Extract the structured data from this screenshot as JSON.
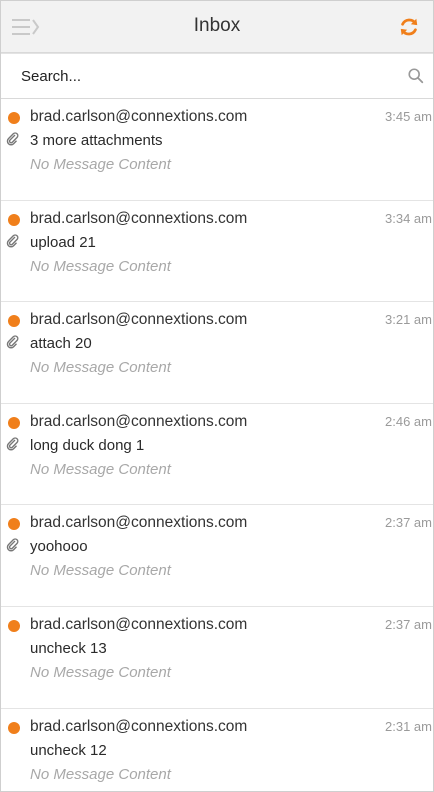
{
  "header": {
    "title": "Inbox",
    "menu_icon": "menu-collapse-icon",
    "refresh_icon": "refresh-icon"
  },
  "search": {
    "placeholder": "Search...",
    "value": "",
    "icon": "search-icon"
  },
  "colors": {
    "accent": "#f07f1b",
    "unread_dot": "#f07f1b",
    "header_bg": "#f2f2f2"
  },
  "messages": [
    {
      "from": "brad.carlson@connextions.com",
      "time": "3:45 am",
      "subject": "3 more attachments",
      "preview": "No Message Content",
      "unread": true,
      "has_attachment": true
    },
    {
      "from": "brad.carlson@connextions.com",
      "time": "3:34 am",
      "subject": "upload 21",
      "preview": "No Message Content",
      "unread": true,
      "has_attachment": true
    },
    {
      "from": "brad.carlson@connextions.com",
      "time": "3:21 am",
      "subject": "attach 20",
      "preview": "No Message Content",
      "unread": true,
      "has_attachment": true
    },
    {
      "from": "brad.carlson@connextions.com",
      "time": "2:46 am",
      "subject": "long duck dong 1",
      "preview": "No Message Content",
      "unread": true,
      "has_attachment": true
    },
    {
      "from": "brad.carlson@connextions.com",
      "time": "2:37 am",
      "subject": "yoohooo",
      "preview": "No Message Content",
      "unread": true,
      "has_attachment": true
    },
    {
      "from": "brad.carlson@connextions.com",
      "time": "2:37 am",
      "subject": "uncheck 13",
      "preview": "No Message Content",
      "unread": true,
      "has_attachment": false
    },
    {
      "from": "brad.carlson@connextions.com",
      "time": "2:31 am",
      "subject": "uncheck 12",
      "preview": "No Message Content",
      "unread": true,
      "has_attachment": false
    }
  ]
}
